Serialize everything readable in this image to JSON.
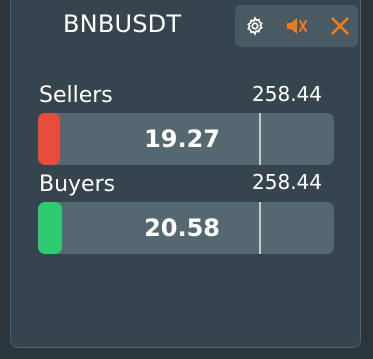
{
  "widget": {
    "symbol": "BNBUSDT"
  },
  "toolbar": {
    "settings_icon": "gear-icon",
    "mute_icon": "speaker-muted-icon",
    "close_icon": "close-icon",
    "accent_color": "#f07a1c"
  },
  "sellers": {
    "label": "Sellers",
    "total": "258.44",
    "value": "19.27",
    "fill_fraction": 0.075,
    "marker_fraction": 0.745,
    "color": "#e74c3c"
  },
  "buyers": {
    "label": "Buyers",
    "total": "258.44",
    "value": "20.58",
    "fill_fraction": 0.08,
    "marker_fraction": 0.745,
    "color": "#2ecc71"
  }
}
